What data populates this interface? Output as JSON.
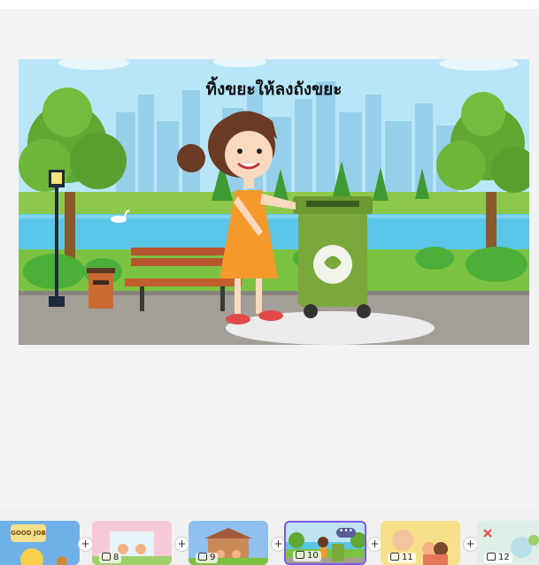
{
  "slide": {
    "title": "ทิ้งขยะให้ลงถังขยะ"
  },
  "filmstrip": {
    "thumbnails": [
      {
        "number": "",
        "title": "GOOD JOB",
        "bg": "#6fb0e8"
      },
      {
        "number": "8",
        "title": "",
        "bg": "#f7c9d6"
      },
      {
        "number": "9",
        "title": "",
        "bg": "#8fc0ee"
      },
      {
        "number": "10",
        "title": "",
        "bg": "#bfe3f3",
        "selected": true
      },
      {
        "number": "11",
        "title": "",
        "bg": "#f6e08a"
      },
      {
        "number": "12",
        "title": "",
        "bg": "#dfeee6"
      }
    ],
    "add_label": "+",
    "more_label": "•••"
  },
  "colors": {
    "selection": "#7a5ae0",
    "bin_green": "#7aa83a"
  }
}
